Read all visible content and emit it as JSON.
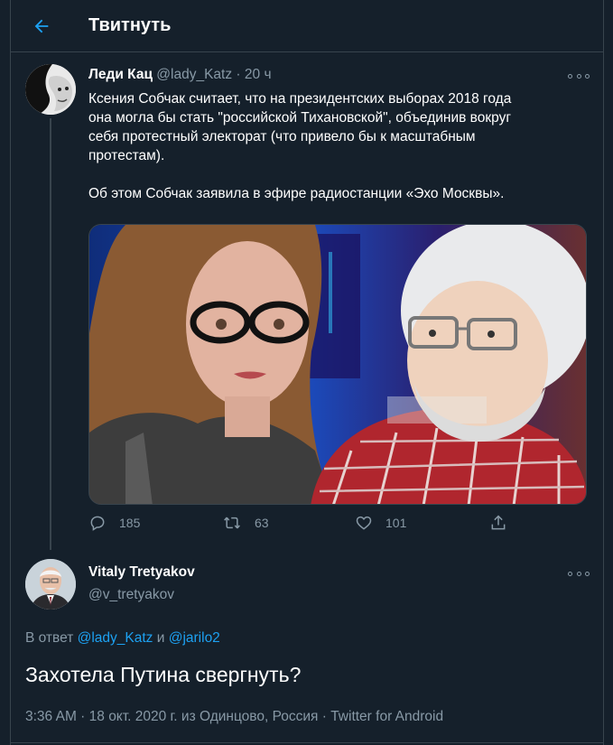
{
  "header": {
    "title": "Твитнуть",
    "back_icon": "arrow-left-icon",
    "accent": "#1da1f2"
  },
  "tweet1": {
    "name": "Леди Кац",
    "handle": "@lady_Katz",
    "separator": "·",
    "time": "20 ч",
    "paragraph1": "Ксения Собчак считает, что на президентских выборах 2018 года\nона могла бы стать \"российской Тихановской\", объединив вокруг\nсебя протестный электорат (что привело бы к масштабным\nпротестам).",
    "paragraph2": "Об этом Собчак заявила в эфире радиостанции «Эхо Москвы».",
    "replies": "185",
    "retweets": "63",
    "likes": "101"
  },
  "tweet2": {
    "name": "Vitaly Tretyakov",
    "handle": "@v_tretyakov",
    "reply_prefix": "В ответ",
    "reply_user1": "@lady_Katz",
    "reply_and": "и",
    "reply_user2": "@jarilo2",
    "text": "Захотела Путина свергнуть?",
    "meta": "3:36 AM · 18 окт. 2020 г. из Одинцово, Россия · Twitter for Android"
  },
  "colors": {
    "background": "#15202b",
    "border": "#38444d",
    "muted": "#8899a6",
    "link": "#1da1f2"
  }
}
